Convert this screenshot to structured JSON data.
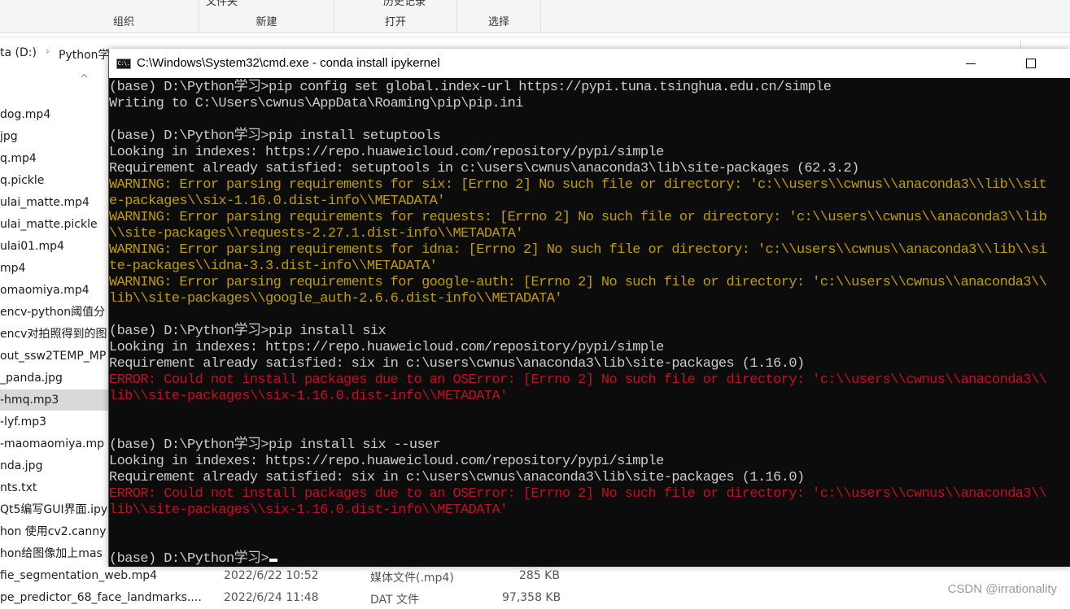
{
  "explorer": {
    "ribbon": {
      "groups": [
        {
          "label": "组织"
        },
        {
          "label": "新建",
          "cut_text": "文件夹"
        },
        {
          "label": "打开",
          "cut_text": "历史记录"
        },
        {
          "label": "选择"
        }
      ]
    },
    "breadcrumb": {
      "items": [
        "ta (D:)",
        "Python学习"
      ],
      "separator": "›"
    },
    "sort_arrow": "^",
    "files": [
      {
        "name": "dog.mp4"
      },
      {
        "name": "jpg"
      },
      {
        "name": "q.mp4"
      },
      {
        "name": "q.pickle"
      },
      {
        "name": "ulai_matte.mp4"
      },
      {
        "name": "ulai_matte.pickle"
      },
      {
        "name": "ulai01.mp4"
      },
      {
        "name": "mp4"
      },
      {
        "name": "omaomiya.mp4"
      },
      {
        "name": "encv-python阈值分"
      },
      {
        "name": "encv对拍照得到的图"
      },
      {
        "name": "out_ssw2TEMP_MP"
      },
      {
        "name": "_panda.jpg"
      },
      {
        "name": "-hmq.mp3",
        "selected": true
      },
      {
        "name": "-lyf.mp3"
      },
      {
        "name": "-maomaomiya.mp"
      },
      {
        "name": "nda.jpg"
      },
      {
        "name": "nts.txt"
      },
      {
        "name": "Qt5编写GUI界面.ipy"
      },
      {
        "name": "hon 使用cv2.canny"
      },
      {
        "name": "hon给图像加上mas"
      }
    ],
    "bottom_rows": [
      {
        "name": "fie_segmentation_web.mp4",
        "date": "2022/6/22 10:52",
        "type": "媒体文件(.mp4)",
        "size": "285 KB"
      },
      {
        "name": "pe_predictor_68_face_landmarks....",
        "date": "2022/6/24 11:48",
        "type": "DAT 文件",
        "size": "97,358 KB"
      }
    ],
    "watermark": "CSDN @irrationality"
  },
  "console": {
    "title": "C:\\Windows\\System32\\cmd.exe - conda  install ipykernel",
    "icon_label": "C:\\.",
    "colors": {
      "normal": "#cccccc",
      "warning": "#c19c00",
      "error": "#c50f1f",
      "background": "#0c0c0c"
    },
    "lines": [
      {
        "text": "(base) D:\\Python学习>pip config set global.index-url https://pypi.tuna.tsinghua.edu.cn/simple",
        "kind": "normal"
      },
      {
        "text": "Writing to C:\\Users\\cwnus\\AppData\\Roaming\\pip\\pip.ini",
        "kind": "normal"
      },
      {
        "text": "",
        "kind": "normal"
      },
      {
        "text": "(base) D:\\Python学习>pip install setuptools",
        "kind": "normal"
      },
      {
        "text": "Looking in indexes: https://repo.huaweicloud.com/repository/pypi/simple",
        "kind": "normal"
      },
      {
        "text": "Requirement already satisfied: setuptools in c:\\users\\cwnus\\anaconda3\\lib\\site-packages (62.3.2)",
        "kind": "normal"
      },
      {
        "text": "WARNING: Error parsing requirements for six: [Errno 2] No such file or directory: 'c:\\\\users\\\\cwnus\\\\anaconda3\\\\lib\\\\sit",
        "kind": "warn"
      },
      {
        "text": "e-packages\\\\six-1.16.0.dist-info\\\\METADATA'",
        "kind": "warn"
      },
      {
        "text": "WARNING: Error parsing requirements for requests: [Errno 2] No such file or directory: 'c:\\\\users\\\\cwnus\\\\anaconda3\\\\lib",
        "kind": "warn"
      },
      {
        "text": "\\\\site-packages\\\\requests-2.27.1.dist-info\\\\METADATA'",
        "kind": "warn"
      },
      {
        "text": "WARNING: Error parsing requirements for idna: [Errno 2] No such file or directory: 'c:\\\\users\\\\cwnus\\\\anaconda3\\\\lib\\\\si",
        "kind": "warn"
      },
      {
        "text": "te-packages\\\\idna-3.3.dist-info\\\\METADATA'",
        "kind": "warn"
      },
      {
        "text": "WARNING: Error parsing requirements for google-auth: [Errno 2] No such file or directory: 'c:\\\\users\\\\cwnus\\\\anaconda3\\\\",
        "kind": "warn"
      },
      {
        "text": "lib\\\\site-packages\\\\google_auth-2.6.6.dist-info\\\\METADATA'",
        "kind": "warn"
      },
      {
        "text": "",
        "kind": "normal"
      },
      {
        "text": "(base) D:\\Python学习>pip install six",
        "kind": "normal"
      },
      {
        "text": "Looking in indexes: https://repo.huaweicloud.com/repository/pypi/simple",
        "kind": "normal"
      },
      {
        "text": "Requirement already satisfied: six in c:\\users\\cwnus\\anaconda3\\lib\\site-packages (1.16.0)",
        "kind": "normal"
      },
      {
        "text": "ERROR: Could not install packages due to an OSError: [Errno 2] No such file or directory: 'c:\\\\users\\\\cwnus\\\\anaconda3\\\\",
        "kind": "err"
      },
      {
        "text": "lib\\\\site-packages\\\\six-1.16.0.dist-info\\\\METADATA'",
        "kind": "err"
      },
      {
        "text": "",
        "kind": "normal"
      },
      {
        "text": "",
        "kind": "normal"
      },
      {
        "text": "(base) D:\\Python学习>pip install six --user",
        "kind": "normal"
      },
      {
        "text": "Looking in indexes: https://repo.huaweicloud.com/repository/pypi/simple",
        "kind": "normal"
      },
      {
        "text": "Requirement already satisfied: six in c:\\users\\cwnus\\anaconda3\\lib\\site-packages (1.16.0)",
        "kind": "normal"
      },
      {
        "text": "ERROR: Could not install packages due to an OSError: [Errno 2] No such file or directory: 'c:\\\\users\\\\cwnus\\\\anaconda3\\\\",
        "kind": "err"
      },
      {
        "text": "lib\\\\site-packages\\\\six-1.16.0.dist-info\\\\METADATA'",
        "kind": "err"
      },
      {
        "text": "",
        "kind": "normal"
      },
      {
        "text": "",
        "kind": "normal"
      },
      {
        "text": "(base) D:\\Python学习>",
        "kind": "normal",
        "cursor": true
      }
    ]
  }
}
